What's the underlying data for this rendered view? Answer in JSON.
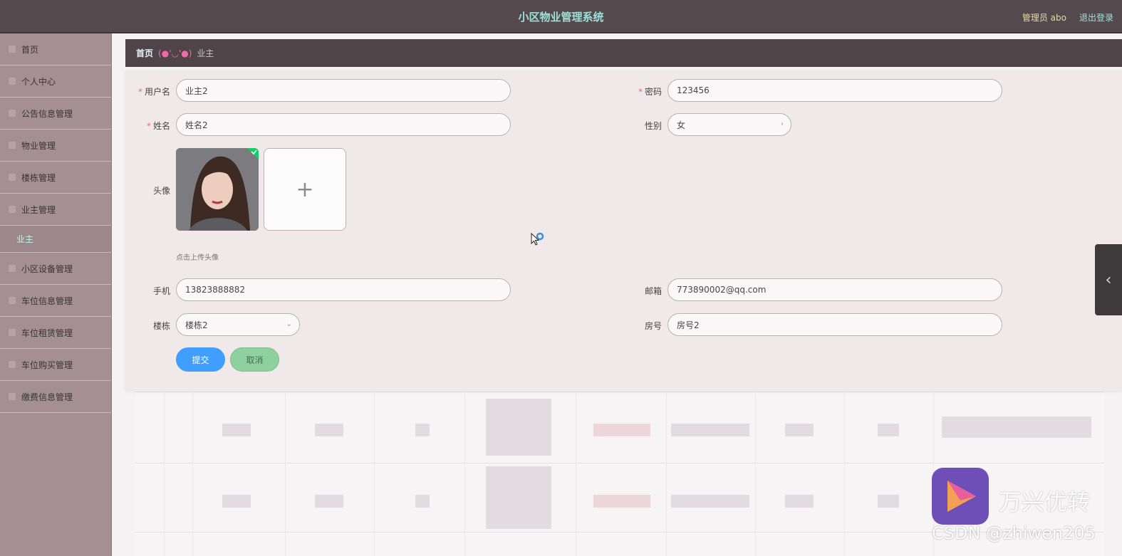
{
  "header": {
    "title": "小区物业管理系统",
    "admin": "管理员 abo",
    "logout": "退出登录"
  },
  "sidebar": {
    "items": [
      {
        "label": "首页",
        "icon": "home-icon"
      },
      {
        "label": "个人中心",
        "icon": "user-icon"
      },
      {
        "label": "公告信息管理",
        "icon": "notice-icon"
      },
      {
        "label": "物业管理",
        "icon": "property-icon"
      },
      {
        "label": "楼栋管理",
        "icon": "building-icon"
      },
      {
        "label": "业主管理",
        "icon": "owner-icon"
      }
    ],
    "sub_item": "业主",
    "items_after": [
      {
        "label": "小区设备管理",
        "icon": "device-icon"
      },
      {
        "label": "车位信息管理",
        "icon": "parking-icon"
      },
      {
        "label": "车位租赁管理",
        "icon": "lease-icon"
      },
      {
        "label": "车位购买管理",
        "icon": "purchase-icon"
      },
      {
        "label": "缴费信息管理",
        "icon": "payment-icon"
      }
    ]
  },
  "breadcrumb": {
    "home": "首页",
    "separator": "(●'◡'●)",
    "current": "业主"
  },
  "form": {
    "username_label": "用户名",
    "username": "业主2",
    "password_label": "密码",
    "password": "123456",
    "name_label": "姓名",
    "name": "姓名2",
    "gender_label": "性别",
    "gender": "女",
    "avatar_label": "头像",
    "upload_plus": "+",
    "upload_tip": "点击上传头像",
    "phone_label": "手机",
    "phone": "13823888882",
    "email_label": "邮箱",
    "email": "773890002@qq.com",
    "building_label": "楼栋",
    "building": "楼栋2",
    "room_label": "房号",
    "room": "房号2",
    "submit": "提交",
    "cancel": "取消"
  },
  "watermark": {
    "brand": "万兴优转",
    "csdn": "CSDN @zhiwen205"
  },
  "colors": {
    "accent": "#409eff",
    "header_bg": "#544a4e",
    "sidebar_bg": "#a49094",
    "required": "#f56c6c"
  }
}
